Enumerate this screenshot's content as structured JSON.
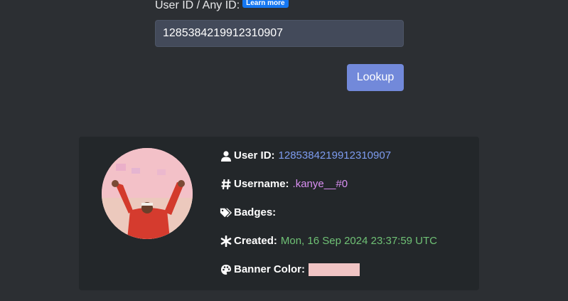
{
  "form": {
    "id_label": "User ID / Any ID:",
    "learn_more": "Learn more",
    "id_value": "1285384219912310907",
    "lookup_label": "Lookup"
  },
  "result": {
    "avatar_icon": "user-avatar-photo",
    "user_id_icon": "user-icon",
    "user_id_key": "User ID:",
    "user_id_value": "1285384219912310907",
    "username_icon": "hash-icon",
    "username_key": "Username:",
    "username_value": ".kanye__#0",
    "badges_icon": "tags-icon",
    "badges_key": "Badges:",
    "created_icon": "asterisk-icon",
    "created_key": "Created:",
    "created_value": "Mon, 16 Sep 2024 23:37:59 UTC",
    "banner_icon": "palette-icon",
    "banner_key": "Banner Color:",
    "banner_color": "#f0c4c4"
  },
  "colors": {
    "background": "#2c2f33",
    "card": "#23272a",
    "button": "#7289da",
    "badge": "#1577f2",
    "id_value": "#7d9cf0",
    "username_value": "#d98ff2",
    "created_value": "#6fc175"
  }
}
